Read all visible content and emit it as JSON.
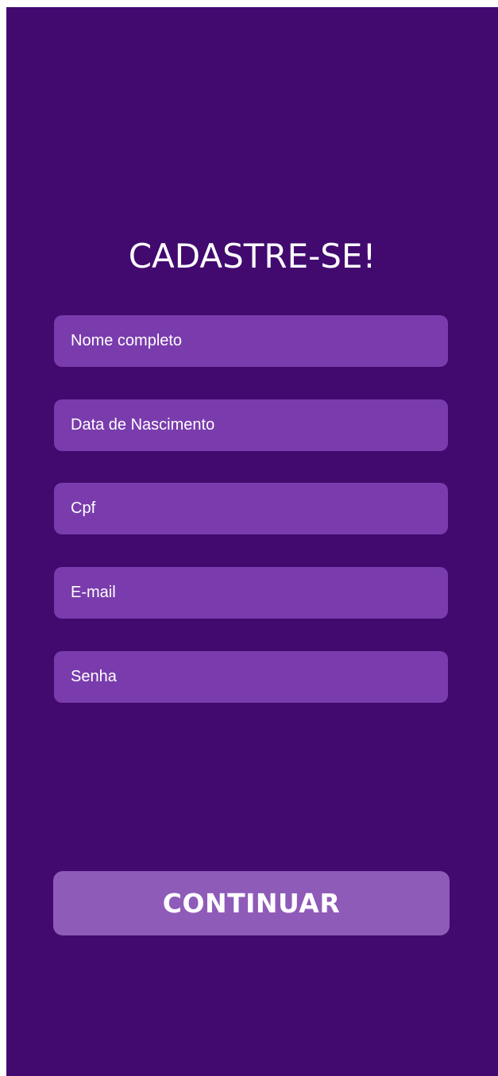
{
  "header": {
    "title": "CADASTRE-SE!"
  },
  "form": {
    "fields": [
      {
        "placeholder": "Nome completo",
        "value": ""
      },
      {
        "placeholder": "Data de Nascimento",
        "value": ""
      },
      {
        "placeholder": "Cpf",
        "value": ""
      },
      {
        "placeholder": "E-mail",
        "value": ""
      },
      {
        "placeholder": "Senha",
        "value": ""
      }
    ],
    "submit_label": "CONTINUAR"
  },
  "colors": {
    "background": "#420a6f",
    "field": "#7a3cad",
    "button": "#8f5bb9",
    "text": "#ffffff"
  }
}
